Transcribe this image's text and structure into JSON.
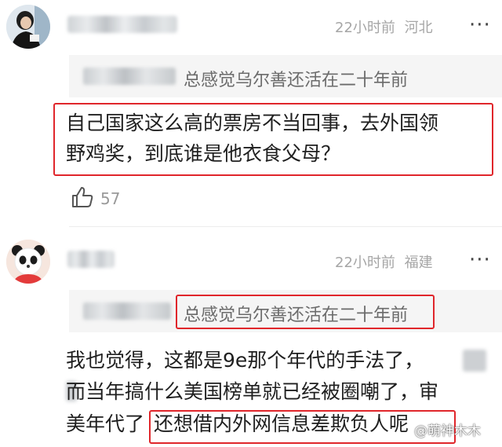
{
  "comments": [
    {
      "time": "22小时前",
      "location": "河北",
      "quote": "总感觉乌尔善还活在二十年前",
      "text_line1": "自己国家这么高的票房不当回事，去外国领",
      "text_line2": "野鸡奖，到底谁是他衣食父母？",
      "likes": "57"
    },
    {
      "time": "22小时前",
      "location": "福建",
      "quote": "总感觉乌尔善还活在二十年前",
      "text_line1": "我也觉得，这都是9e那个年代的手法了，",
      "text_line2": "而当年搞什么美国榜单就已经被圈嘲了，审",
      "text_line3a": "美年代了",
      "text_line3b": "还想借内外网信息差欺负人呢"
    }
  ],
  "watermark": "@萌神木木",
  "icons": {
    "like": "thumbs-up-icon",
    "more": "more-dots-icon"
  },
  "colors": {
    "highlight": "#e0262b",
    "meta": "#a6a6a6"
  }
}
